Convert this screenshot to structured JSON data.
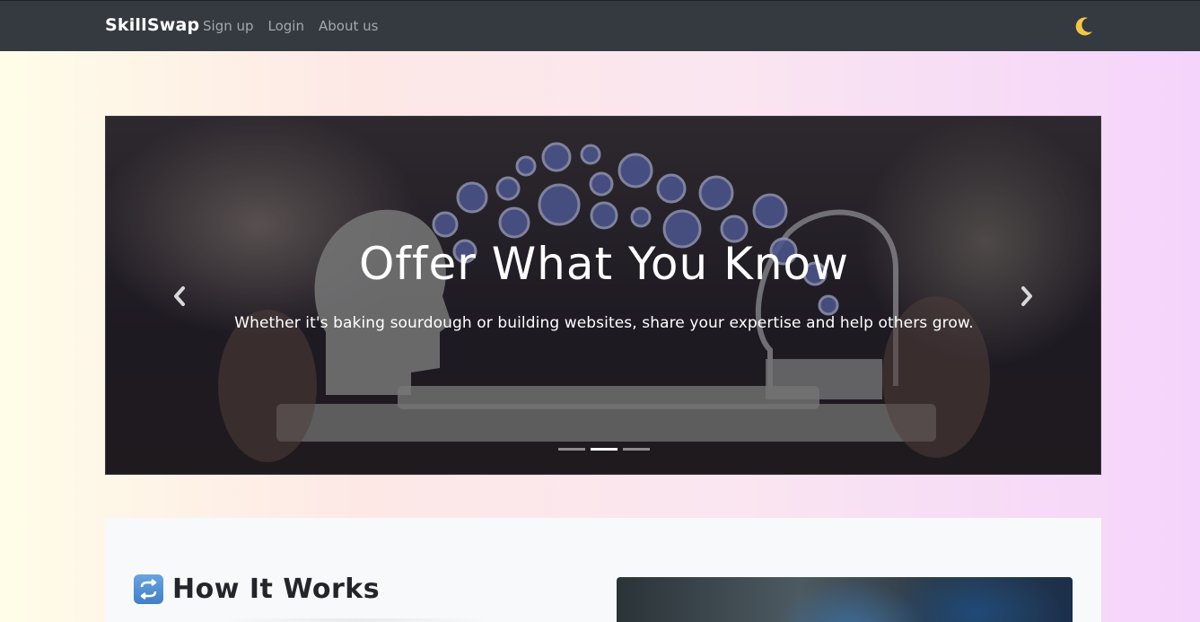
{
  "navbar": {
    "brand": "SkillSwap",
    "links": [
      "Sign up",
      "Login",
      "About us"
    ],
    "theme_icon": "crescent-moon-icon"
  },
  "carousel": {
    "slide_title": "Offer What You Know",
    "slide_text": "Whether it's baking sourdough or building websites, share your expertise and help others grow.",
    "slide_count": 3,
    "active_slide": 2,
    "prev_icon": "chevron-left-icon",
    "next_icon": "chevron-right-icon"
  },
  "how_it_works": {
    "icon": "repeat-icon",
    "title": "How It Works"
  },
  "colors": {
    "navbar_bg": "#343a40",
    "brand": "#ffffff",
    "nav_link": "#a4a8ac",
    "panel_bg": "#f8f9fa"
  }
}
